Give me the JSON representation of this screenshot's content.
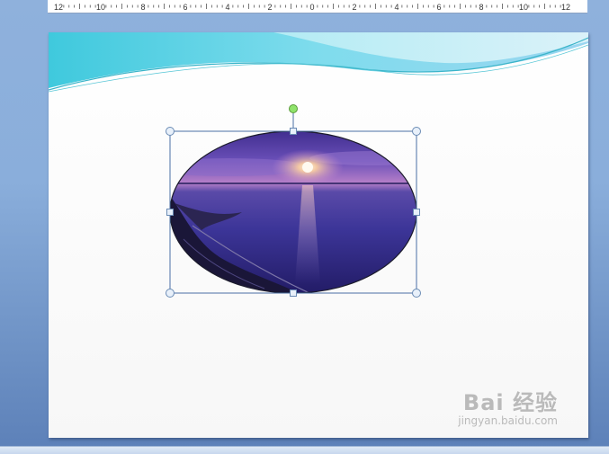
{
  "ruler": {
    "labels": [
      "12",
      "10",
      "8",
      "6",
      "4",
      "2",
      "0",
      "2",
      "4",
      "6",
      "8",
      "10",
      "12"
    ]
  },
  "slide": {
    "picture": {
      "shape": "ellipse",
      "subject": "sunset over sea and coastal road",
      "selected": true
    }
  },
  "watermark": {
    "main": "Bai 经验",
    "sub": "jingyan.baidu.com"
  },
  "colors": {
    "handle_rotate": "#8fe36b",
    "handle_border": "#6a8bb4",
    "selection_line": "#4a6fa5",
    "wave_teal": "#5fd6e4"
  }
}
